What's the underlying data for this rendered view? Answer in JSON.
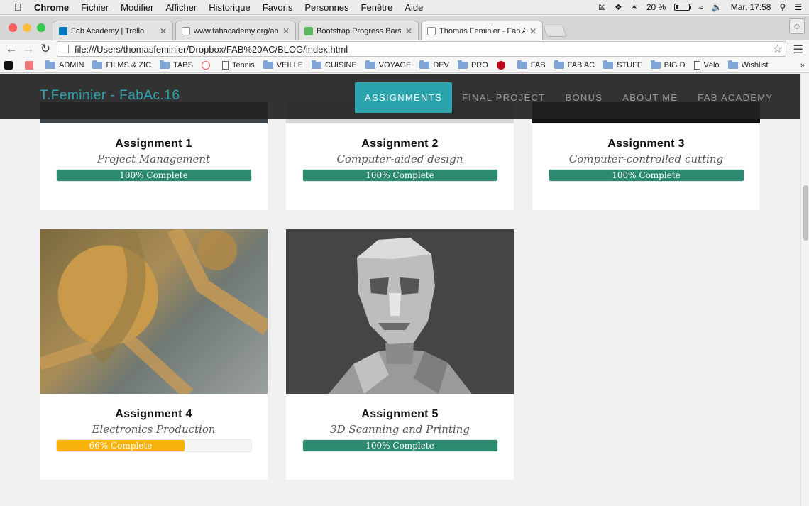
{
  "menubar": {
    "apple_icon": "apple-icon",
    "items": [
      "Chrome",
      "Fichier",
      "Modifier",
      "Afficher",
      "Historique",
      "Favoris",
      "Personnes",
      "Fenêtre",
      "Aide"
    ],
    "battery": "20 %",
    "clock": "Mar. 17:58"
  },
  "tabs": [
    {
      "title": "Fab Academy | Trello",
      "favicon_color": "#0079bf"
    },
    {
      "title": "www.fabacademy.org/archi",
      "favicon_color": "#ffffff"
    },
    {
      "title": "Bootstrap Progress Bars",
      "favicon_color": "#5cb85c"
    },
    {
      "title": "Thomas Feminier - Fab Ac",
      "favicon_color": "#ffffff"
    }
  ],
  "omnibox": {
    "url": "file:///Users/thomasfeminier/Dropbox/FAB%20AC/BLOG/index.html"
  },
  "bookmarks": [
    {
      "label": "",
      "kind": "fav-n"
    },
    {
      "label": "",
      "kind": "fav-img"
    },
    {
      "label": "ADMIN",
      "kind": "folder"
    },
    {
      "label": "FILMS & ZIC",
      "kind": "folder"
    },
    {
      "label": "TABS",
      "kind": "folder"
    },
    {
      "label": "",
      "kind": "fav-airbnb"
    },
    {
      "label": "Tennis",
      "kind": "doc"
    },
    {
      "label": "VEILLE",
      "kind": "folder"
    },
    {
      "label": "CUISINE",
      "kind": "folder"
    },
    {
      "label": "VOYAGE",
      "kind": "folder"
    },
    {
      "label": "DEV",
      "kind": "folder"
    },
    {
      "label": "PRO",
      "kind": "folder"
    },
    {
      "label": "",
      "kind": "fav-pinterest"
    },
    {
      "label": "FAB",
      "kind": "folder"
    },
    {
      "label": "FAB AC",
      "kind": "folder"
    },
    {
      "label": "STUFF",
      "kind": "folder"
    },
    {
      "label": "BIG D",
      "kind": "folder"
    },
    {
      "label": "Vélo",
      "kind": "doc"
    },
    {
      "label": "Wishlist",
      "kind": "folder"
    }
  ],
  "bookmarks_more": "»",
  "site": {
    "brand": "T.Feminier - FabAc.16",
    "nav": [
      "ASSIGNMENTS",
      "FINAL PROJECT",
      "BONUS",
      "ABOUT ME",
      "FAB ACADEMY"
    ],
    "active_nav": "ASSIGNMENTS",
    "accent": "#2aa3ad"
  },
  "assignments": [
    {
      "title": "Assignment 1",
      "subtitle": "Project Management",
      "progress": 100,
      "progress_label": "100% Complete",
      "bar_color": "#2b8a6f"
    },
    {
      "title": "Assignment 2",
      "subtitle": "Computer-aided design",
      "progress": 100,
      "progress_label": "100% Complete",
      "bar_color": "#2b8a6f"
    },
    {
      "title": "Assignment 3",
      "subtitle": "Computer-controlled cutting",
      "progress": 100,
      "progress_label": "100% Complete",
      "bar_color": "#2b8a6f"
    },
    {
      "title": "Assignment 4",
      "subtitle": "Electronics Production",
      "progress": 66,
      "progress_label": "66% Complete",
      "bar_color": "#f7b20c",
      "image": "pcb-photo"
    },
    {
      "title": "Assignment 5",
      "subtitle": "3D Scanning and Printing",
      "progress": 100,
      "progress_label": "100% Complete",
      "bar_color": "#2b8a6f",
      "image": "low-poly-bust"
    }
  ]
}
